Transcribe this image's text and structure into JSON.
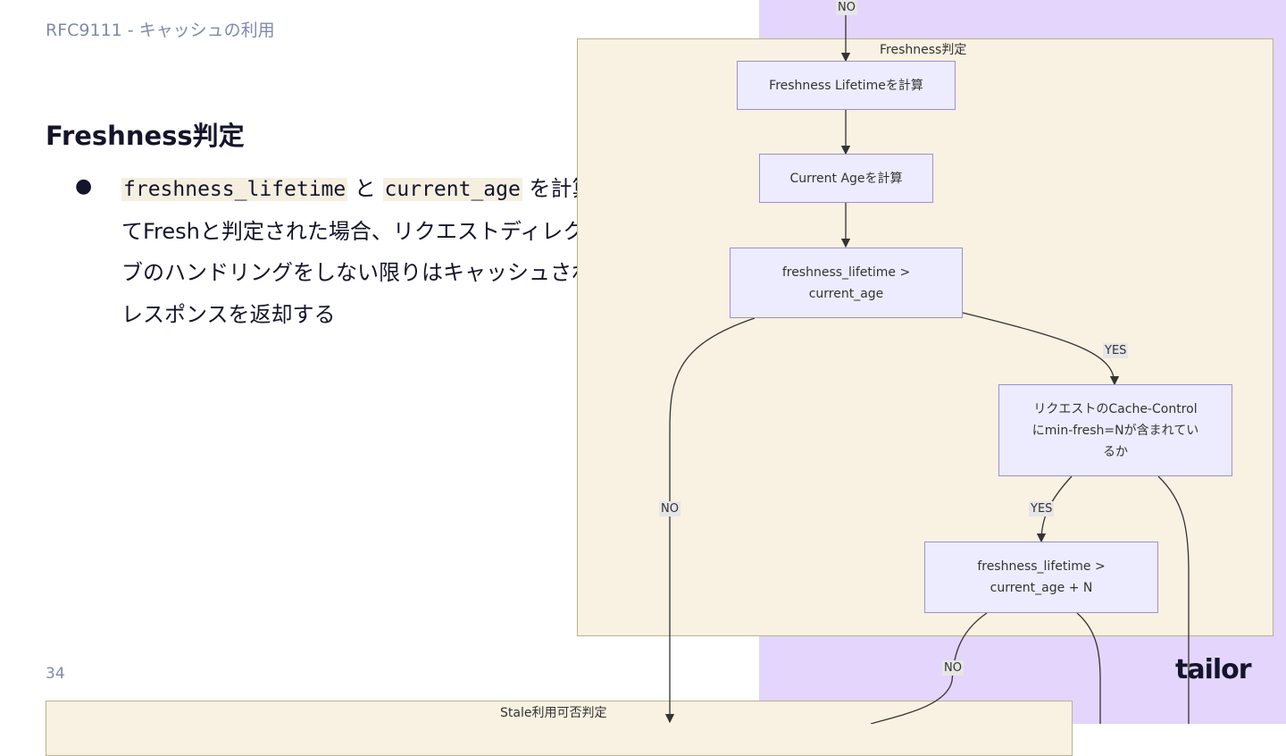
{
  "header": {
    "breadcrumb": "RFC9111 - キャッシュの利用"
  },
  "slide": {
    "title": "Freshness判定",
    "bullet": {
      "code1": "freshness_lifetime",
      "connector": " と ",
      "code2": "current_age",
      "rest": " を計算してFreshと判定された場合、リクエストディレクティブのハンドリングをしない限りはキャッシュされたレスポンスを返却する"
    }
  },
  "footer": {
    "page_number": "34",
    "logo": "tailor"
  },
  "diagram": {
    "clusters": {
      "freshness": "Freshness判定",
      "stale": "Stale利用可否判定"
    },
    "nodes": {
      "calc_lifetime": "Freshness Lifetimeを計算",
      "calc_age": "Current Ageを計算",
      "compare_basic": "freshness_lifetime >\ncurrent_age",
      "min_fresh_check": "リクエストのCache-Control\nにmin-fresh=Nが含まれてい\nるか",
      "compare_min_fresh": "freshness_lifetime >\ncurrent_age + N"
    },
    "edge_labels": {
      "top_no": "NO",
      "compare_yes": "YES",
      "compare_no": "NO",
      "min_fresh_yes": "YES",
      "bottom_no": "NO"
    }
  },
  "colors": {
    "accent_panel": "#e3d5fb",
    "cluster_fill": "#f9f1e2",
    "node_fill": "#ececfe",
    "node_border": "#9c8fd6"
  }
}
